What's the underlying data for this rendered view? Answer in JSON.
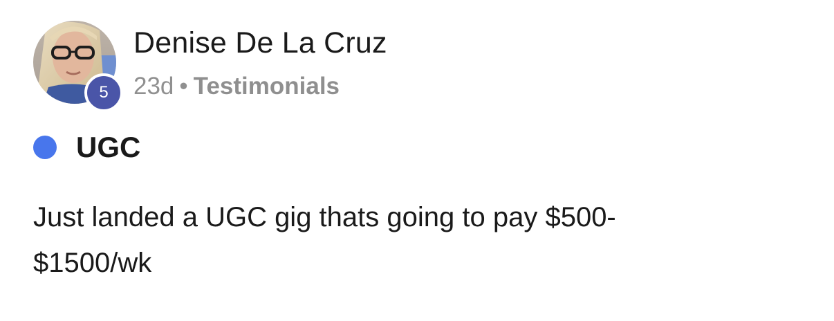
{
  "post": {
    "author": {
      "name": "Denise De La Cruz",
      "level": "5"
    },
    "meta": {
      "age": "23d",
      "separator": "•",
      "category": "Testimonials"
    },
    "title": "UGC",
    "body_lines": [
      "Just landed a UGC gig thats going to pay $500-",
      "$1500/wk"
    ]
  },
  "colors": {
    "level_badge": "#4a55a8",
    "title_dot": "#4876ec",
    "meta_text": "#909090",
    "primary_text": "#1a1a1a"
  },
  "icons": {
    "avatar": "profile-photo",
    "title_dot": "blue-dot-icon"
  }
}
